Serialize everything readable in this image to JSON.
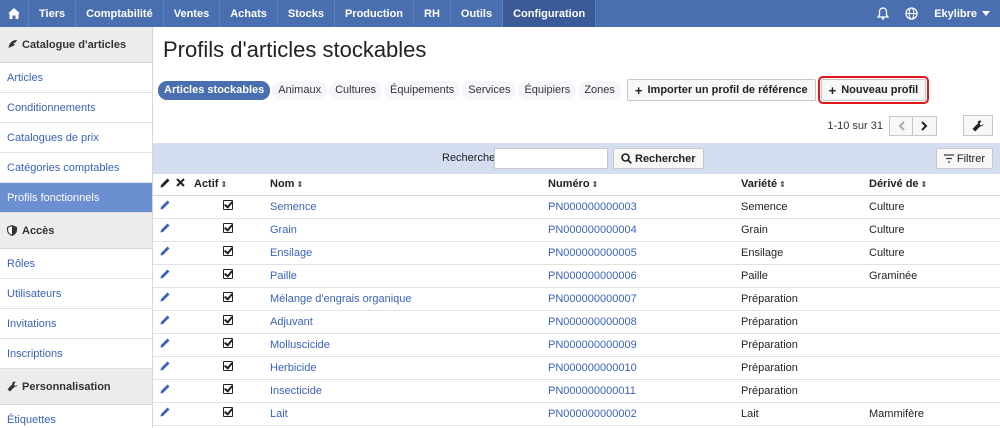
{
  "topnav": {
    "items": [
      "Tiers",
      "Comptabilité",
      "Ventes",
      "Achats",
      "Stocks",
      "Production",
      "RH",
      "Outils",
      "Configuration"
    ],
    "active": "Configuration",
    "user": "Ekylibre"
  },
  "sidebar": {
    "sections": [
      {
        "title": "Catalogue d'articles",
        "icon": "feather-icon",
        "items": [
          "Articles",
          "Conditionnements",
          "Catalogues de prix",
          "Catégories comptables",
          "Profils fonctionnels"
        ]
      },
      {
        "title": "Accès",
        "icon": "shield-icon",
        "items": [
          "Rôles",
          "Utilisateurs",
          "Invitations",
          "Inscriptions"
        ]
      },
      {
        "title": "Personnalisation",
        "icon": "wrench-icon",
        "items": [
          "Étiquettes"
        ]
      }
    ],
    "active_item": "Profils fonctionnels"
  },
  "page": {
    "title": "Profils d'articles stockables",
    "tabs": [
      "Articles stockables",
      "Animaux",
      "Cultures",
      "Équipements",
      "Services",
      "Équipiers",
      "Zones"
    ],
    "active_tab": "Articles stockables",
    "import_label": "Importer un profil de référence",
    "new_label": "Nouveau profil"
  },
  "pager": {
    "count": "1-10 sur 31"
  },
  "search": {
    "label": "Rechercher",
    "input_value": "",
    "button_label": "Rechercher",
    "filter_label": "Filtrer"
  },
  "table": {
    "headers": {
      "actif": "Actif",
      "nom": "Nom",
      "numero": "Numéro",
      "variete": "Variété",
      "derive": "Dérivé de"
    },
    "rows": [
      {
        "nom": "Semence",
        "numero": "PN000000000003",
        "variete": "Semence",
        "derive": "Culture"
      },
      {
        "nom": "Grain",
        "numero": "PN000000000004",
        "variete": "Grain",
        "derive": "Culture"
      },
      {
        "nom": "Ensilage",
        "numero": "PN000000000005",
        "variete": "Ensilage",
        "derive": "Culture"
      },
      {
        "nom": "Paille",
        "numero": "PN000000000006",
        "variete": "Paille",
        "derive": "Graminée"
      },
      {
        "nom": "Mélange d'engrais organique",
        "numero": "PN000000000007",
        "variete": "Préparation",
        "derive": ""
      },
      {
        "nom": "Adjuvant",
        "numero": "PN000000000008",
        "variete": "Préparation",
        "derive": ""
      },
      {
        "nom": "Molluscicide",
        "numero": "PN000000000009",
        "variete": "Préparation",
        "derive": ""
      },
      {
        "nom": "Herbicide",
        "numero": "PN000000000010",
        "variete": "Préparation",
        "derive": ""
      },
      {
        "nom": "Insecticide",
        "numero": "PN000000000011",
        "variete": "Préparation",
        "derive": ""
      },
      {
        "nom": "Lait",
        "numero": "PN000000000002",
        "variete": "Lait",
        "derive": "Mammifère"
      }
    ]
  },
  "colors": {
    "nav": "#4a6fb0",
    "link": "#3a63b8",
    "highlight": "#e0161b"
  }
}
